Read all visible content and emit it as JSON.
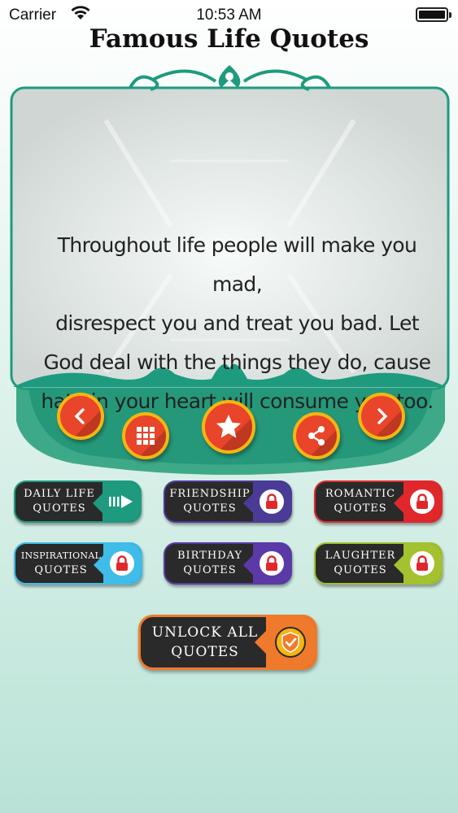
{
  "status_bar": {
    "carrier": "Carrier",
    "time": "10:53 AM",
    "icons": [
      "wifi-icon",
      "battery-icon"
    ]
  },
  "app": {
    "title": "Famous Life Quotes"
  },
  "quote": {
    "lines": [
      "Throughout life people will make you mad,",
      "disrespect you and treat you bad. Let",
      "God deal with the things they do, cause",
      "hate in your heart will consume you too."
    ]
  },
  "controls": {
    "icons": [
      "chevron-left-icon",
      "grid-icon",
      "star-icon",
      "share-icon",
      "chevron-right-icon"
    ]
  },
  "categories": [
    {
      "line1": "DAILY LIFE",
      "line2": "QUOTES",
      "icon": "arrow-right-icon",
      "color": "#1e9b7e"
    },
    {
      "line1": "FRIENDSHIP",
      "line2": "QUOTES",
      "icon": "lock-icon",
      "color": "#4a3c96"
    },
    {
      "line1": "ROMANTIC",
      "line2": "QUOTES",
      "icon": "lock-icon",
      "color": "#e0282c"
    },
    {
      "line1": "INSPIRATIONAL",
      "line2": "QUOTES",
      "icon": "lock-icon",
      "color": "#3fbde8"
    },
    {
      "line1": "BIRTHDAY",
      "line2": "QUOTES",
      "icon": "lock-icon",
      "color": "#5b3aa8"
    },
    {
      "line1": "LAUGHTER",
      "line2": "QUOTES",
      "icon": "lock-icon",
      "color": "#a4c12f"
    }
  ],
  "unlock": {
    "line1": "UNLOCK ALL",
    "line2": "QUOTES",
    "icon": "shield-check-icon",
    "color": "#f07a2b"
  },
  "colors": {
    "teal": "#1e9b7e",
    "button_red": "#e8452a",
    "button_ring": "#f6b511"
  }
}
